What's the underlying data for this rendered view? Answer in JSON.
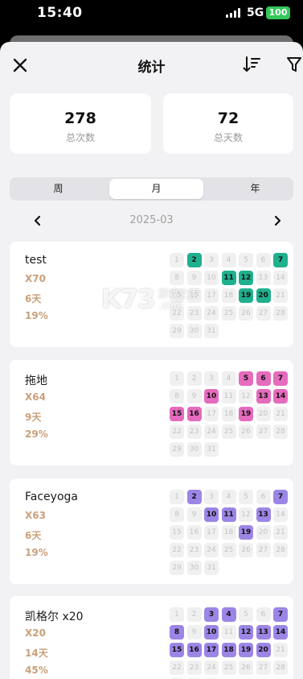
{
  "status_bar": {
    "time": "15:40",
    "network": "5G",
    "battery": "100"
  },
  "header": {
    "title": "统计",
    "close_icon": "close-icon",
    "sort_icon": "sort-icon",
    "filter_icon": "filter-icon"
  },
  "stats": {
    "total_count": {
      "value": "278",
      "label": "总次数"
    },
    "total_days": {
      "value": "72",
      "label": "总天数"
    }
  },
  "segment": {
    "tabs": [
      "周",
      "月",
      "年"
    ],
    "selected": "月"
  },
  "month_nav": {
    "label": "2025-03"
  },
  "calendar_days": [
    "1",
    "2",
    "3",
    "4",
    "5",
    "6",
    "7",
    "8",
    "9",
    "10",
    "11",
    "12",
    "13",
    "14",
    "15",
    "16",
    "17",
    "18",
    "19",
    "20",
    "21",
    "22",
    "23",
    "24",
    "25",
    "26",
    "27",
    "28",
    "29",
    "30",
    "31"
  ],
  "habits": [
    {
      "name": "test",
      "count": "X70",
      "days": "6天",
      "percent": "19%",
      "color": "#1fb08e",
      "marked": [
        2,
        7,
        11,
        12,
        19,
        20
      ]
    },
    {
      "name": "拖地",
      "count": "X64",
      "days": "9天",
      "percent": "29%",
      "color": "#e56bbd",
      "marked": [
        5,
        6,
        7,
        10,
        13,
        14,
        15,
        16,
        19
      ]
    },
    {
      "name": "Faceyoga",
      "count": "X63",
      "days": "6天",
      "percent": "19%",
      "color": "#9b86e6",
      "marked": [
        2,
        7,
        10,
        11,
        13,
        19
      ]
    },
    {
      "name": "凯格尔 x20",
      "count": "X20",
      "days": "14天",
      "percent": "45%",
      "color": "#9b86e6",
      "marked": [
        3,
        4,
        7,
        8,
        10,
        12,
        13,
        14,
        15,
        16,
        17,
        18,
        19,
        20
      ]
    }
  ],
  "watermark": {
    "logo": "K73",
    "text": "游戏之家",
    "domain": ".com"
  }
}
